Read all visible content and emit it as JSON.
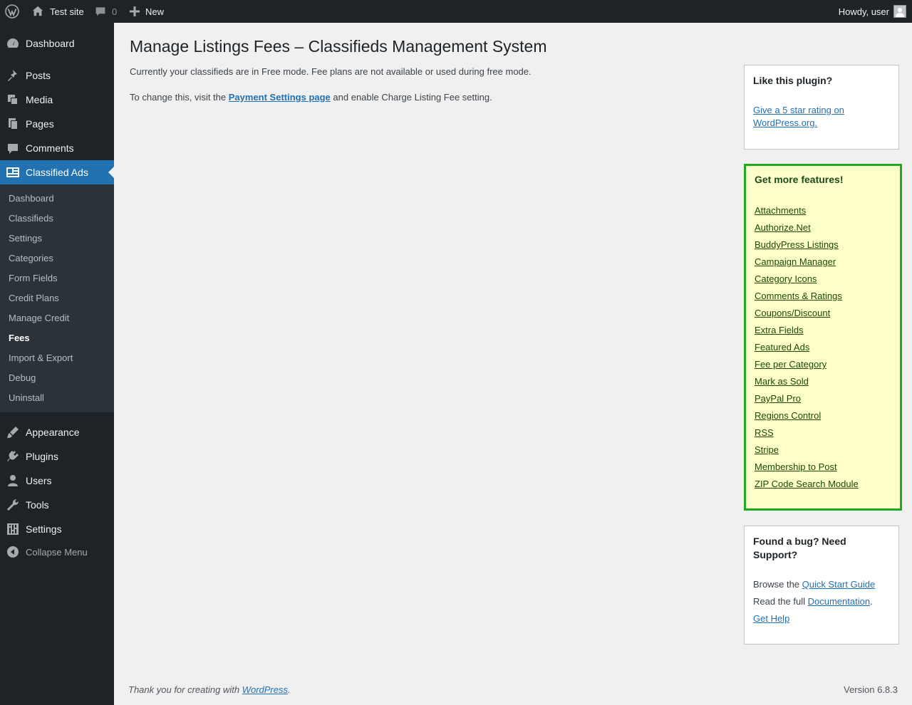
{
  "adminbar": {
    "site_name": "Test site",
    "comments_count": "0",
    "new_label": "New",
    "howdy": "Howdy, user"
  },
  "sidebar": {
    "top_items": [
      {
        "label": "Dashboard",
        "icon": "dashboard-icon"
      },
      {
        "label": "Posts",
        "icon": "pushpin-icon"
      },
      {
        "label": "Media",
        "icon": "media-icon"
      },
      {
        "label": "Pages",
        "icon": "pages-icon"
      },
      {
        "label": "Comments",
        "icon": "comment-icon"
      },
      {
        "label": "Classified Ads",
        "icon": "classified-ads-icon"
      }
    ],
    "submenu": [
      "Dashboard",
      "Classifieds",
      "Settings",
      "Categories",
      "Form Fields",
      "Credit Plans",
      "Manage Credit",
      "Fees",
      "Import & Export",
      "Debug",
      "Uninstall"
    ],
    "current_submenu": "Fees",
    "bottom_items": [
      {
        "label": "Appearance",
        "icon": "brush-icon"
      },
      {
        "label": "Plugins",
        "icon": "plugin-icon"
      },
      {
        "label": "Users",
        "icon": "user-icon"
      },
      {
        "label": "Tools",
        "icon": "wrench-icon"
      },
      {
        "label": "Settings",
        "icon": "settings-icon"
      }
    ],
    "collapse_label": "Collapse Menu"
  },
  "main": {
    "title": "Manage Listings Fees – Classifieds Management System",
    "note1": "Currently your classifieds are in Free mode. Fee plans are not available or used during free mode.",
    "note2_pre": "To change this, visit the ",
    "note2_link": "Payment Settings page",
    "note2_post": " and enable Charge Listing Fee setting."
  },
  "like_box": {
    "title": "Like this plugin?",
    "link_line1": "Give a 5 star rating on",
    "link_line2": "WordPress.org."
  },
  "features_box": {
    "title": "Get more features!",
    "items": [
      "Attachments",
      "Authorize.Net",
      "BuddyPress Listings",
      "Campaign Manager",
      "Category Icons",
      "Comments & Ratings",
      "Coupons/Discount",
      "Extra Fields",
      "Featured Ads",
      "Fee per Category",
      "Mark as Sold",
      "PayPal Pro",
      "Regions Control",
      "RSS",
      "Stripe",
      "Membership to Post",
      "ZIP Code Search Module"
    ]
  },
  "support_box": {
    "title_line1": "Found a bug? Need",
    "title_line2": "Support?",
    "browse_pre": "Browse the ",
    "browse_link": "Quick Start Guide",
    "read_pre": "Read the full ",
    "read_link": "Documentation",
    "read_post": ".",
    "help_link": "Get Help"
  },
  "footer": {
    "thanks_pre": "Thank you for creating with ",
    "thanks_link": "WordPress",
    "thanks_post": ".",
    "version": "Version 6.8.3"
  },
  "colors": {
    "admin_dark": "#1d2327",
    "accent": "#2271b1",
    "features_bg": "#ffffcc",
    "features_border": "#20a820"
  }
}
